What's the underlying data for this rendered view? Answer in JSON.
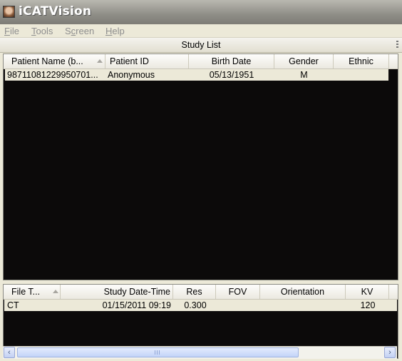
{
  "window": {
    "title": "iCATVision"
  },
  "menu": [
    {
      "pre": "",
      "accel": "F",
      "post": "ile"
    },
    {
      "pre": "",
      "accel": "T",
      "post": "ools"
    },
    {
      "pre": "S",
      "accel": "c",
      "post": "reen"
    },
    {
      "pre": "",
      "accel": "H",
      "post": "elp"
    }
  ],
  "study_list": {
    "title": "Study List",
    "columns": [
      "Patient Name (b...",
      "Patient ID",
      "Birth Date",
      "Gender",
      "Ethnic"
    ],
    "rows": [
      [
        "98711081229950701...",
        "Anonymous",
        "05/13/1951",
        "M",
        ""
      ]
    ]
  },
  "file_list": {
    "columns": [
      "File T...",
      "Study Date-Time",
      "Res",
      "FOV",
      "Orientation",
      "KV"
    ],
    "rows": [
      [
        "CT",
        "01/15/2011 09:19",
        "0.300",
        "",
        "",
        "120"
      ]
    ]
  },
  "scrollbar": {
    "left_arrow": "‹",
    "right_arrow": "›"
  }
}
